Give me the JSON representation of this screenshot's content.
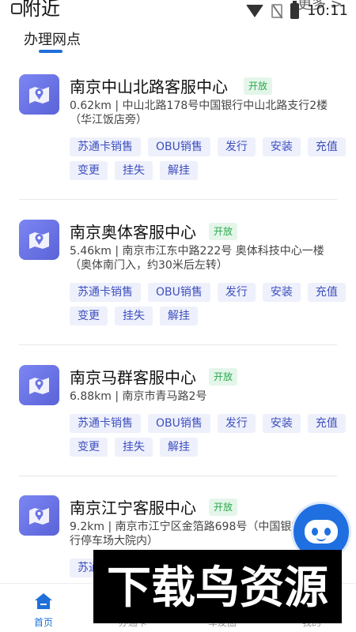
{
  "status_bar": {
    "title": "附近",
    "more": "更多 >",
    "time": "10:11"
  },
  "section": {
    "title": "办理网点"
  },
  "stations": [
    {
      "name": "南京中山北路客服中心",
      "status": "开放",
      "address": "0.62km | 中山北路178号中国银行中山北路支行2楼（华江饭店旁）",
      "services": [
        "苏通卡销售",
        "OBU销售",
        "发行",
        "安装",
        "充值"
      ],
      "services2": [
        "变更",
        "挂失",
        "解挂"
      ]
    },
    {
      "name": "南京奥体客服中心",
      "status": "开放",
      "address": "5.46km | 南京市江东中路222号 奥体科技中心一楼（奥体南门入，约30米后左转）",
      "services": [
        "苏通卡销售",
        "OBU销售",
        "发行",
        "安装",
        "充值"
      ],
      "services2": [
        "变更",
        "挂失",
        "解挂"
      ]
    },
    {
      "name": "南京马群客服中心",
      "status": "开放",
      "address": "6.88km | 南京市青马路2号",
      "services": [
        "苏通卡销售",
        "OBU销售",
        "发行",
        "安装",
        "充值"
      ],
      "services2": [
        "变更",
        "挂失",
        "解挂"
      ]
    },
    {
      "name": "南京江宁客服中心",
      "status": "开放",
      "address": "9.2km | 南京市江宁区金箔路698号（中国银行江宁支行停车场大院内）",
      "services": [
        "苏通卡销售"
      ],
      "services2": []
    }
  ],
  "watermark": {
    "text": "下载鸟资源"
  },
  "nav": {
    "items": [
      {
        "label": "首页",
        "icon": "home-icon",
        "active": true
      },
      {
        "label": "办通卡",
        "icon": "card-icon",
        "active": false
      },
      {
        "label": "车友圈",
        "icon": "community-icon",
        "active": false
      },
      {
        "label": "我的",
        "icon": "profile-icon",
        "active": false
      }
    ]
  },
  "colors": {
    "accent": "#1e6fd9",
    "open": "#2aa84a",
    "tag_text": "#3d4fbf",
    "tag_bg": "#eef0fb"
  }
}
